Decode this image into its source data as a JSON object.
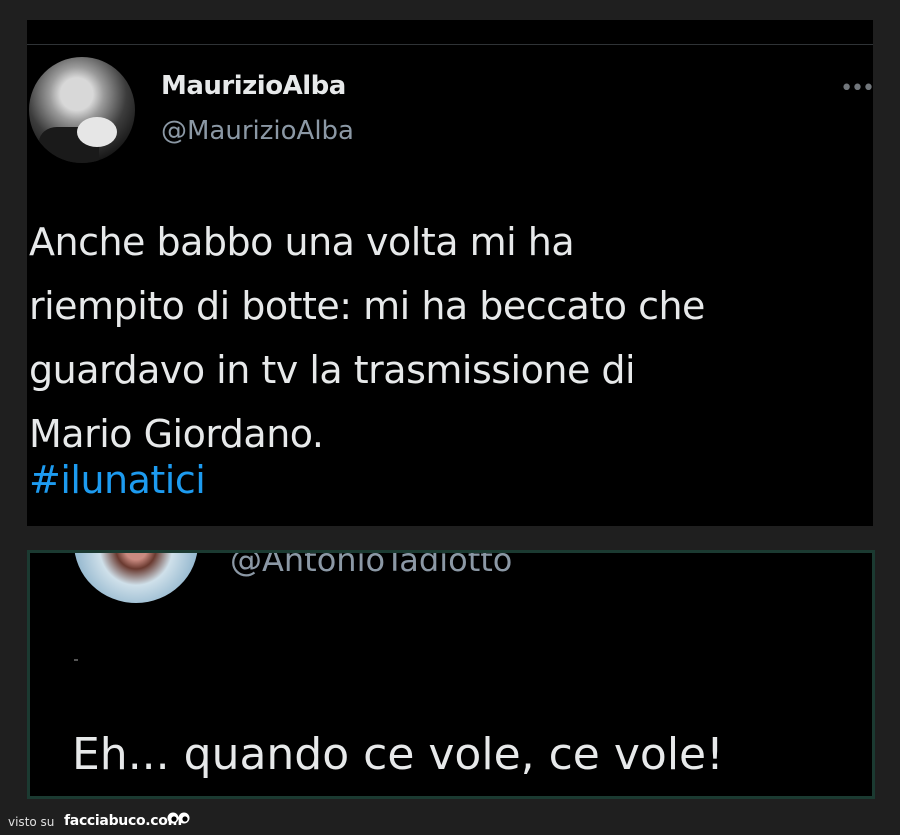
{
  "tweet": {
    "display_name": "MaurizioAlba",
    "handle": "@MaurizioAlba",
    "more_icon": "more-horizontal-icon",
    "more_glyph": "•••",
    "text_lines": [
      "Anche babbo una volta mi ha",
      "riempito di botte: mi ha beccato che",
      "guardavo in tv la trasmissione di",
      "Mario Giordano."
    ],
    "hashtag": "#ilunatici"
  },
  "reply": {
    "handle": "@AntonioTadiotto",
    "text": "Eh... quando ce vole, ce vole!"
  },
  "footer": {
    "visto_label": "visto su",
    "site": "facciabuco.com"
  },
  "colors": {
    "background": "#1f1f1f",
    "tweet_bg": "#000000",
    "text": "#e7e9ea",
    "muted": "#8b98a5",
    "hashtag": "#1d9bf0",
    "reply_border": "#1b3a31"
  }
}
